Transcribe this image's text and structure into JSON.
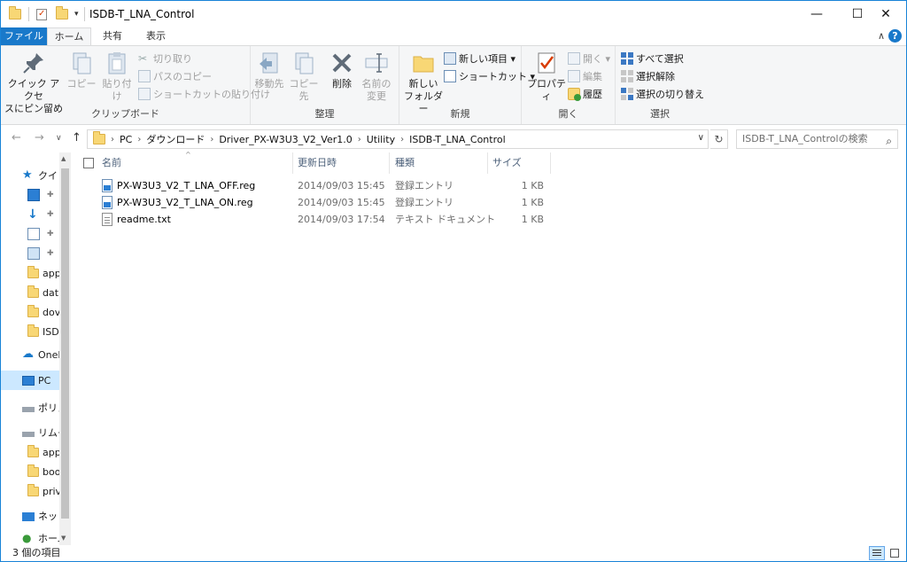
{
  "window": {
    "title": "ISDB-T_LNA_Control",
    "controls": {
      "minimize": "—",
      "maximize": "☐",
      "close": "✕"
    }
  },
  "ribbon_tabs": {
    "file": "ファイル",
    "home": "ホーム",
    "share": "共有",
    "view": "表示",
    "collapse": "∧",
    "help": "?"
  },
  "ribbon": {
    "clipboard": {
      "label": "クリップボード",
      "pin_quick_access": [
        "クイック アクセ",
        "スにピン留め"
      ],
      "copy": "コピー",
      "paste": "貼り付け",
      "cut": "切り取り",
      "copy_path": "パスのコピー",
      "paste_shortcut": "ショートカットの貼り付け"
    },
    "organize": {
      "label": "整理",
      "move_to": "移動先",
      "copy_to": "コピー先",
      "delete": "削除",
      "rename": [
        "名前の",
        "変更"
      ]
    },
    "new": {
      "label": "新規",
      "new_folder": [
        "新しい",
        "フォルダー"
      ],
      "new_item": "新しい項目 ▾",
      "easy_access": "ショートカット ▾"
    },
    "open": {
      "label": "開く",
      "properties": "プロパティ",
      "open": "開く ▾",
      "edit": "編集",
      "history": "履歴"
    },
    "select": {
      "label": "選択",
      "select_all": "すべて選択",
      "select_none": "選択解除",
      "invert": "選択の切り替え"
    }
  },
  "address": {
    "back": "←",
    "forward": "→",
    "recent": "∨",
    "up": "↑",
    "breadcrumbs": [
      "PC",
      "ダウンロード",
      "Driver_PX-W3U3_V2_Ver1.0",
      "Utility",
      "ISDB-T_LNA_Control"
    ],
    "dropdown": "∨",
    "refresh": "↻",
    "search_placeholder": "ISDB-T_LNA_Controlの検索",
    "search_icon": "⌕"
  },
  "nav": {
    "quick_access": "クイッ",
    "folders": [
      "app",
      "dat",
      "dov",
      "ISD"
    ],
    "onedrive": "OneI",
    "pc": "PC",
    "drive1": "ポリュ",
    "drive2": "リムー",
    "drive2_folders": [
      "app",
      "boo",
      "priv"
    ],
    "network": "ネット",
    "homegroup": "ホーム"
  },
  "columns": {
    "name": "名前",
    "date": "更新日時",
    "type": "種類",
    "size": "サイズ",
    "sort_indicator": "^"
  },
  "files": [
    {
      "name": "PX-W3U3_V2_T_LNA_OFF.reg",
      "date": "2014/09/03 15:45",
      "type": "登録エントリ",
      "size": "1 KB",
      "icon": "reg-file-icon"
    },
    {
      "name": "PX-W3U3_V2_T_LNA_ON.reg",
      "date": "2014/09/03 15:45",
      "type": "登録エントリ",
      "size": "1 KB",
      "icon": "reg-file-icon"
    },
    {
      "name": "readme.txt",
      "date": "2014/09/03 17:54",
      "type": "テキスト ドキュメント",
      "size": "1 KB",
      "icon": "text-file-icon"
    }
  ],
  "status": {
    "item_count": "3 個の項目"
  },
  "colors": {
    "accent": "#1979ca",
    "selection": "#cce8ff",
    "folder": "#f8d775"
  }
}
